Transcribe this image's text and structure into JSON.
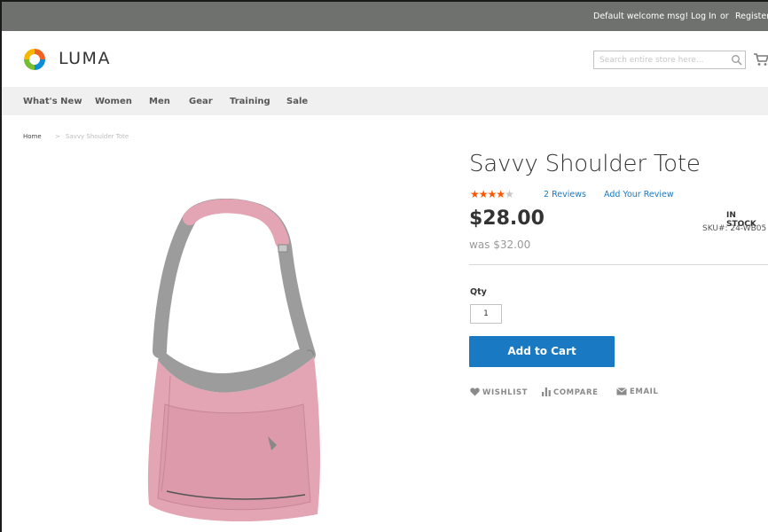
{
  "topbar": {
    "welcome": "Default welcome msg!",
    "login": "Log In",
    "or": "or",
    "register": "Register"
  },
  "header": {
    "logo_text": "LUMA",
    "search_placeholder": "Search entire store here...",
    "icons": [
      "luma-logo-icon",
      "search-icon",
      "cart-icon"
    ]
  },
  "nav": {
    "items": [
      "What's New",
      "Women",
      "Men",
      "Gear",
      "Training",
      "Sale"
    ]
  },
  "breadcrumb": {
    "home": "Home",
    "separator": ">",
    "current": "Savvy Shoulder Tote"
  },
  "product": {
    "name": "Savvy Shoulder Tote",
    "rating_stars": 4,
    "rating_max": 5,
    "reviews_label": "2 Reviews",
    "add_review_label": "Add Your Review",
    "price": "$28.00",
    "old_price": "was $32.00",
    "stock": "IN STOCK",
    "sku": "SKU#:  24-WB05",
    "qty_label": "Qty",
    "qty_value": "1",
    "add_to_cart": "Add to Cart",
    "wishlist": "WISHLIST",
    "compare": "COMPARE",
    "email": "EMAIL"
  },
  "colors": {
    "topbar": "#6e716e",
    "nav_bg": "#f0f0f0",
    "accent_blue": "#1979c3",
    "star_on": "#ff5501",
    "star_off": "#c7c7c7",
    "bag_pink": "#e3a4b3",
    "strap_gray": "#9c9c9c"
  }
}
